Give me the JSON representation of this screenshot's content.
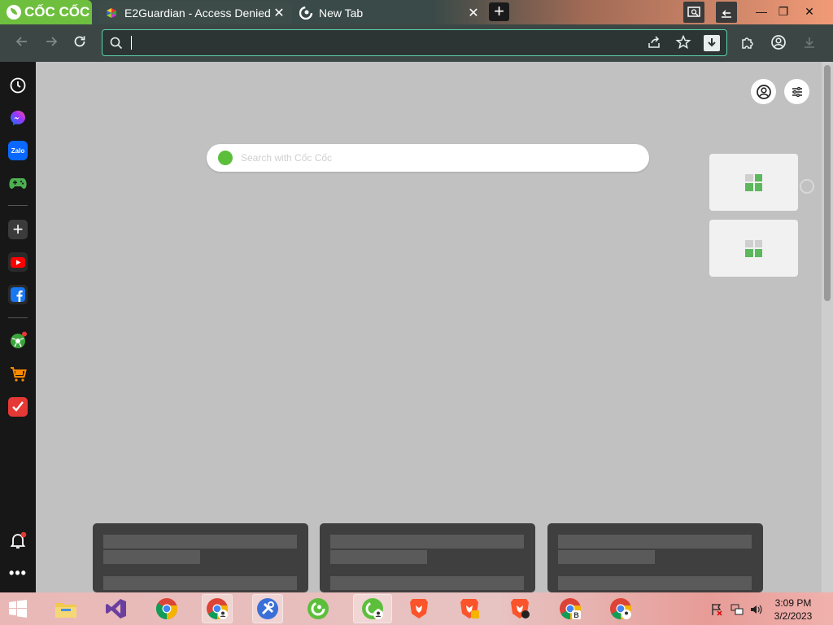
{
  "browser": {
    "brand": "CỐC CỐC",
    "tabs": [
      {
        "label": "E2Guardian - Access Denied",
        "close": "✕",
        "active": true
      },
      {
        "label": "New Tab",
        "close": "✕",
        "active": false
      }
    ],
    "new_tab_symbol": "+",
    "window_controls": {
      "minimize": "—",
      "maximize": "❐",
      "close": "✕"
    }
  },
  "address_bar": {
    "value": "",
    "placeholder": ""
  },
  "new_tab_page": {
    "search_placeholder": "Search with Cốc Cốc"
  },
  "sidebar": {
    "items": [
      "history",
      "messenger",
      "zalo",
      "games",
      "add",
      "youtube",
      "facebook",
      "soccer",
      "shopping",
      "todo"
    ],
    "zalo_label": "Zalo"
  },
  "taskbar": {
    "time": "3:09 PM",
    "date": "3/2/2023"
  },
  "colors": {
    "accent": "#59d3a8",
    "brand_green": "#6fbf3f",
    "content_bg": "#c1c1c1"
  }
}
